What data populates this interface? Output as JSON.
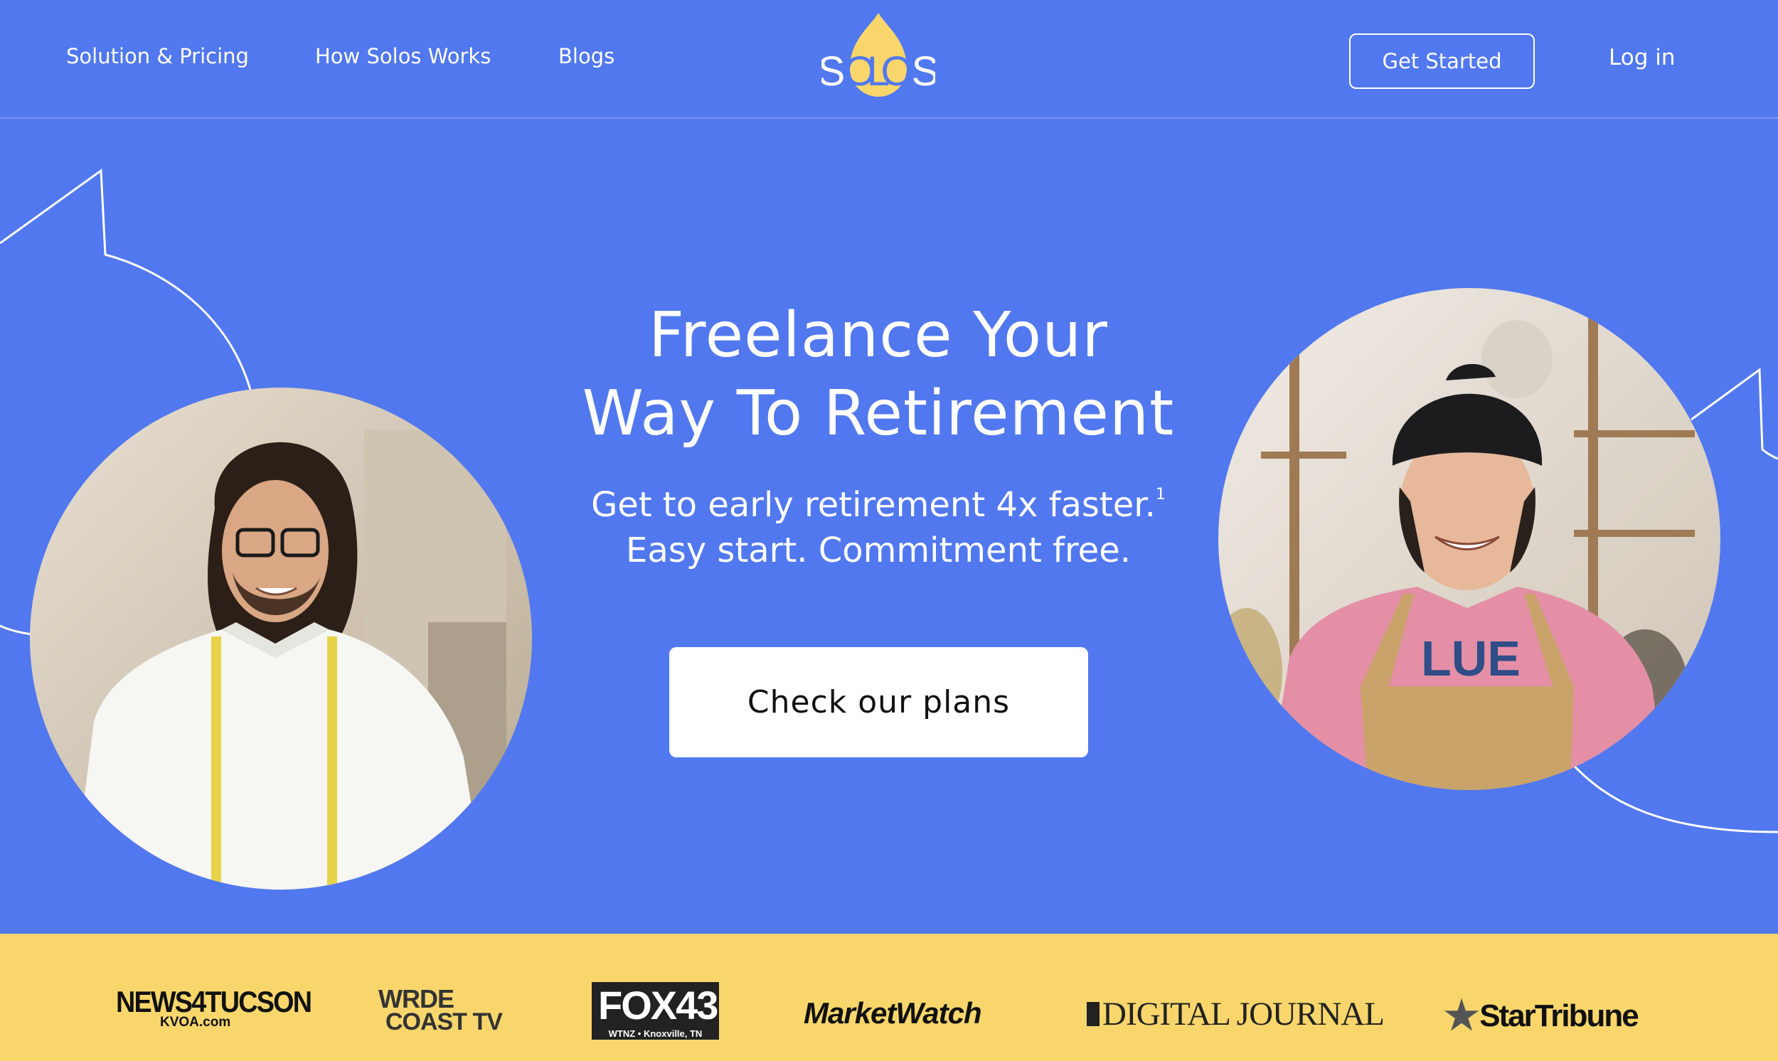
{
  "nav": {
    "links": [
      "Solution & Pricing",
      "How Solos Works",
      "Blogs"
    ],
    "logo_text": "SOLOS",
    "get_started": "Get Started",
    "login": "Log in"
  },
  "hero": {
    "title_line1": "Freelance Your",
    "title_line2": "Way To Retirement",
    "sub_line1": "Get to early retirement 4x faster.",
    "sub_sup": "1",
    "sub_line2": "Easy start. Commitment free.",
    "cta": "Check our plans"
  },
  "press": {
    "news4_main": "NEWS4TUCSON",
    "news4_sub": "KVOA.com",
    "wrde_line1": "WRDE",
    "wrde_line2": "COAST TV",
    "fox_main": "FOX43",
    "fox_sub": "WTNZ • Knoxville, TN",
    "marketwatch": "MarketWatch",
    "digital_journal": "DIGITAL JOURNAL",
    "startribune": "StarTribune"
  },
  "colors": {
    "hero_bg": "#5178ee",
    "press_bg": "#f8d66c",
    "logo_yellow": "#f8d66c",
    "cta_bg": "#ffffff"
  }
}
